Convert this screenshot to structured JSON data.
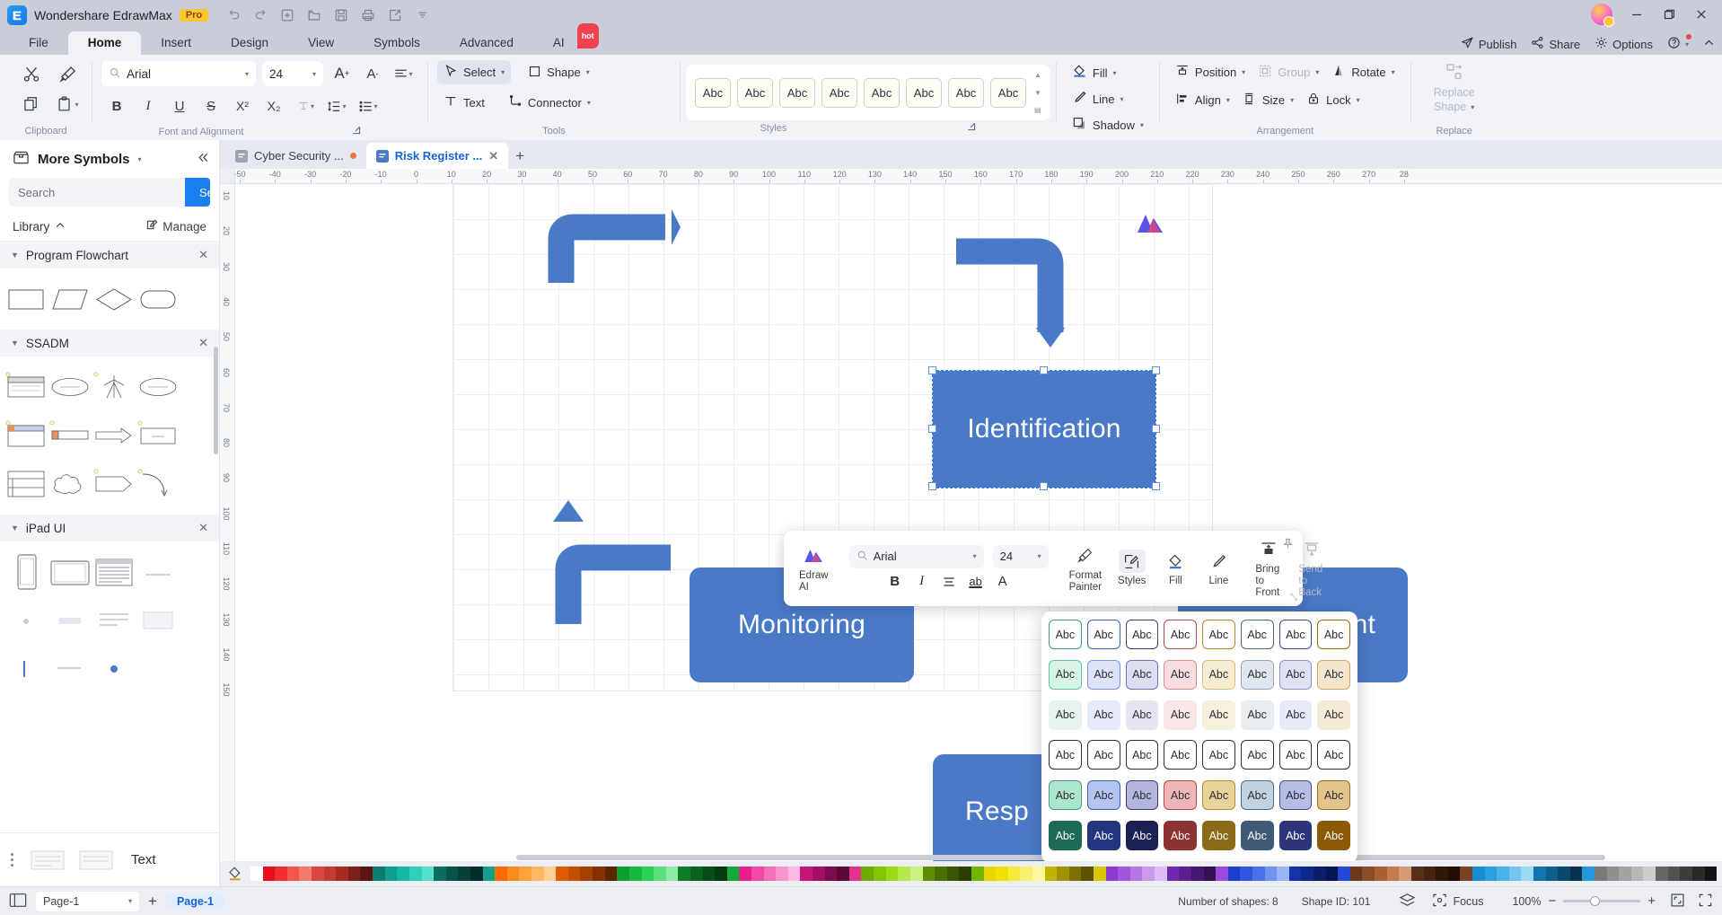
{
  "titlebar": {
    "app_name": "Wondershare EdrawMax",
    "badge": "Pro",
    "quick_access": [
      "undo-icon",
      "redo-icon",
      "new-icon",
      "open-icon",
      "save-icon",
      "print-icon",
      "export-icon",
      "more-icon"
    ],
    "window_controls": [
      "minimize",
      "maximize",
      "close"
    ]
  },
  "menu": {
    "tabs": [
      {
        "label": "File",
        "active": false
      },
      {
        "label": "Home",
        "active": true
      },
      {
        "label": "Insert",
        "active": false
      },
      {
        "label": "Design",
        "active": false
      },
      {
        "label": "View",
        "active": false
      },
      {
        "label": "Symbols",
        "active": false
      },
      {
        "label": "Advanced",
        "active": false
      },
      {
        "label": "AI",
        "active": false,
        "badge": "hot"
      }
    ],
    "right": [
      {
        "label": "Publish",
        "icon": "publish-icon"
      },
      {
        "label": "Share",
        "icon": "share-icon"
      },
      {
        "label": "Options",
        "icon": "gear-icon"
      },
      {
        "label": "",
        "icon": "help-icon"
      },
      {
        "label": "",
        "icon": "chevron-up-icon"
      }
    ]
  },
  "ribbon": {
    "groups": [
      {
        "name": "Clipboard",
        "label": "Clipboard"
      },
      {
        "name": "Font and Alignment",
        "label": "Font and Alignment"
      },
      {
        "name": "Tools",
        "label": "Tools"
      },
      {
        "name": "Styles",
        "label": "Styles"
      },
      {
        "name": "Arrangement",
        "label": "Arrangement"
      },
      {
        "name": "Replace",
        "label": "Replace"
      }
    ],
    "clipboard": {
      "cut": "cut-icon",
      "format_painter": "format-painter-icon",
      "copy": "copy-icon",
      "paste": "paste-icon"
    },
    "font": {
      "family": "Arial",
      "family_placeholder": "Arial",
      "size": "24",
      "grow": "A+",
      "shrink": "A-",
      "bold": "B",
      "italic": "I",
      "underline": "U",
      "strike": "S",
      "sup": "X²",
      "sub": "X₂",
      "text_effect": "text-effect-icon",
      "line_spacing": "line-spacing-icon",
      "bullets": "bullets-icon",
      "align": "align-icon",
      "highlight": "ab",
      "font_color": "A"
    },
    "tools": [
      {
        "label": "Select",
        "selected": true,
        "icon": "cursor-icon"
      },
      {
        "label": "Shape",
        "selected": false,
        "icon": "square-icon"
      },
      {
        "label": "Text",
        "selected": false,
        "icon": "text-icon"
      },
      {
        "label": "Connector",
        "selected": false,
        "icon": "connector-icon"
      }
    ],
    "styles_gallery": {
      "swatch_label": "Abc",
      "count": 8
    },
    "shape_format": [
      {
        "label": "Fill",
        "icon": "fill-icon"
      },
      {
        "label": "Line",
        "icon": "line-icon"
      },
      {
        "label": "Shadow",
        "icon": "shadow-icon"
      }
    ],
    "arrangement": [
      {
        "label": "Position",
        "icon": "position-icon",
        "disabled": false
      },
      {
        "label": "Group",
        "icon": "group-icon",
        "disabled": true
      },
      {
        "label": "Rotate",
        "icon": "rotate-icon",
        "disabled": false
      },
      {
        "label": "Align",
        "icon": "align-objects-icon",
        "disabled": false
      },
      {
        "label": "Size",
        "icon": "size-icon",
        "disabled": false
      },
      {
        "label": "Lock",
        "icon": "lock-icon",
        "disabled": false
      }
    ],
    "replace": {
      "label_line1": "Replace",
      "label_line2": "Shape",
      "icon": "replace-shape-icon",
      "disabled": true
    }
  },
  "sidebar": {
    "title": "More Symbols",
    "title_icon": "symbols-box-icon",
    "collapse_icon": "collapse-left-icon",
    "search": {
      "placeholder": "Search",
      "button": "Search",
      "value": ""
    },
    "library_label": "Library",
    "manage_label": "Manage",
    "categories": [
      {
        "name": "Program Flowchart",
        "shapes": [
          "rectangle",
          "parallelogram",
          "diamond",
          "rounded-rect"
        ]
      },
      {
        "name": "SSADM",
        "shapes": [
          "attribute-box",
          "external-entity",
          "resource-flow",
          "process-source",
          "window-form",
          "data-store-bar",
          "arrow",
          "entity-box",
          "entity-table",
          "cloud",
          "arrow-pentagon",
          "curve-arrow"
        ]
      },
      {
        "name": "iPad UI",
        "shapes": [
          "ipad-portrait",
          "ipad-landscape",
          "ipad-list",
          "misc-1",
          "misc-2",
          "misc-3",
          "misc-4",
          "misc-5",
          "misc-6"
        ]
      }
    ],
    "footer_label": "Text"
  },
  "tabs": {
    "documents": [
      {
        "label": "Cyber Security ...",
        "active": false,
        "modified": true
      },
      {
        "label": "Risk Register ...",
        "active": true,
        "modified": false
      }
    ],
    "add_label": "+"
  },
  "ruler": {
    "h_ticks": [
      "-50",
      "-40",
      "-30",
      "-20",
      "-10",
      "0",
      "10",
      "20",
      "30",
      "40",
      "50",
      "60",
      "70",
      "80",
      "90",
      "100",
      "110",
      "120",
      "130",
      "140",
      "150",
      "160",
      "170",
      "180",
      "190",
      "200",
      "210",
      "220",
      "230",
      "240",
      "250",
      "260",
      "270",
      "28"
    ],
    "v_ticks": [
      "10",
      "20",
      "30",
      "40",
      "50",
      "60",
      "70",
      "80",
      "90",
      "100",
      "110",
      "120",
      "130",
      "140",
      "150"
    ]
  },
  "canvas": {
    "nodes": [
      {
        "id": "identification",
        "label": "Identification",
        "selected": true
      },
      {
        "id": "monitoring",
        "label": "Monitoring",
        "selected": false
      },
      {
        "id": "assessment",
        "label": "nt",
        "selected": false
      },
      {
        "id": "response",
        "label": "Resp",
        "selected": false
      }
    ],
    "watermark": "edraw-ai-logo"
  },
  "context_toolbar": {
    "brand": "Edraw AI",
    "font_family": "Arial",
    "font_size": "24",
    "buttons": [
      "B",
      "I",
      "align-icon",
      "ab",
      "A"
    ],
    "items": [
      {
        "label": "Format Painter",
        "icon": "format-painter-icon",
        "disabled": false,
        "selected": false
      },
      {
        "label": "Styles",
        "icon": "styles-icon",
        "disabled": false,
        "selected": true
      },
      {
        "label": "Fill",
        "icon": "fill-icon",
        "disabled": false,
        "selected": false
      },
      {
        "label": "Line",
        "icon": "line-icon",
        "disabled": false,
        "selected": false
      },
      {
        "label": "Bring to Front",
        "icon": "bring-front-icon",
        "disabled": false,
        "selected": false
      },
      {
        "label": "Send to Back",
        "icon": "send-back-icon",
        "disabled": true,
        "selected": false
      }
    ],
    "pin_icon": "pin-icon"
  },
  "styles_popup": {
    "swatch_label": "Abc",
    "rows": [
      [
        {
          "bg": "#ffffff",
          "border": "#3f9d7d",
          "color": "#2b2d35"
        },
        {
          "bg": "#ffffff",
          "border": "#3b5fb5",
          "color": "#2b2d35"
        },
        {
          "bg": "#ffffff",
          "border": "#3b3f77",
          "color": "#2b2d35"
        },
        {
          "bg": "#ffffff",
          "border": "#b04a4a",
          "color": "#2b2d35"
        },
        {
          "bg": "#ffffff",
          "border": "#b38a2b",
          "color": "#2b2d35"
        },
        {
          "bg": "#ffffff",
          "border": "#4a6b8a",
          "color": "#2b2d35"
        },
        {
          "bg": "#ffffff",
          "border": "#3d4a8f",
          "color": "#2b2d35"
        },
        {
          "bg": "#ffffff",
          "border": "#9a6b1e",
          "color": "#2b2d35"
        }
      ],
      [
        {
          "bg": "#d9f3e6",
          "border": "#59c79c",
          "color": "#2b2d35"
        },
        {
          "bg": "#dde4f8",
          "border": "#7b93dd",
          "color": "#2b2d35"
        },
        {
          "bg": "#dcdef0",
          "border": "#6e72ad",
          "color": "#2b2d35"
        },
        {
          "bg": "#f8dede",
          "border": "#dd8c8c",
          "color": "#2b2d35"
        },
        {
          "bg": "#f6edd5",
          "border": "#d9bc72",
          "color": "#2b2d35"
        },
        {
          "bg": "#e0e7ee",
          "border": "#93a8bd",
          "color": "#2b2d35"
        },
        {
          "bg": "#dfe2f3",
          "border": "#8a90cd",
          "color": "#2b2d35"
        },
        {
          "bg": "#f3e6cd",
          "border": "#cda863",
          "color": "#2b2d35"
        }
      ],
      [
        {
          "bg": "#e4f4ec",
          "border": "transparent",
          "color": "#2b2d35"
        },
        {
          "bg": "#e4eaf9",
          "border": "transparent",
          "color": "#2b2d35"
        },
        {
          "bg": "#e5e6f2",
          "border": "transparent",
          "color": "#2b2d35"
        },
        {
          "bg": "#f9e7e7",
          "border": "transparent",
          "color": "#2b2d35"
        },
        {
          "bg": "#f7f0dc",
          "border": "transparent",
          "color": "#2b2d35"
        },
        {
          "bg": "#e8edf2",
          "border": "transparent",
          "color": "#2b2d35"
        },
        {
          "bg": "#e7e9f6",
          "border": "transparent",
          "color": "#2b2d35"
        },
        {
          "bg": "#f5ead6",
          "border": "transparent",
          "color": "#2b2d35"
        }
      ],
      [
        {
          "bg": "#ffffff",
          "border": "#2f2f33",
          "color": "#2b2d35"
        },
        {
          "bg": "#ffffff",
          "border": "#2f2f33",
          "color": "#2b2d35"
        },
        {
          "bg": "#ffffff",
          "border": "#2f2f33",
          "color": "#2b2d35"
        },
        {
          "bg": "#ffffff",
          "border": "#2f2f33",
          "color": "#2b2d35"
        },
        {
          "bg": "#ffffff",
          "border": "#2f2f33",
          "color": "#2b2d35"
        },
        {
          "bg": "#ffffff",
          "border": "#2f2f33",
          "color": "#2b2d35"
        },
        {
          "bg": "#ffffff",
          "border": "#2f2f33",
          "color": "#2b2d35"
        },
        {
          "bg": "#ffffff",
          "border": "#2f2f33",
          "color": "#2b2d35"
        }
      ],
      [
        {
          "bg": "#aee5cd",
          "border": "#3f9d7d",
          "color": "#2b2d35"
        },
        {
          "bg": "#b6c4f0",
          "border": "#3b5fb5",
          "color": "#2b2d35"
        },
        {
          "bg": "#b2b5dd",
          "border": "#3b3f77",
          "color": "#2b2d35"
        },
        {
          "bg": "#eeb6b6",
          "border": "#b04a4a",
          "color": "#2b2d35"
        },
        {
          "bg": "#e8d39a",
          "border": "#b38a2b",
          "color": "#2b2d35"
        },
        {
          "bg": "#c2d2de",
          "border": "#4a6b8a",
          "color": "#2b2d35"
        },
        {
          "bg": "#b8bde6",
          "border": "#3d4a8f",
          "color": "#2b2d35"
        },
        {
          "bg": "#e4c48d",
          "border": "#9a6b1e",
          "color": "#2b2d35"
        }
      ],
      [
        {
          "bg": "#1d6b55",
          "border": "#1d6b55",
          "color": "#ffffff"
        },
        {
          "bg": "#23357e",
          "border": "#23357e",
          "color": "#ffffff"
        },
        {
          "bg": "#1c2154",
          "border": "#1c2154",
          "color": "#ffffff"
        },
        {
          "bg": "#8e3333",
          "border": "#8e3333",
          "color": "#ffffff"
        },
        {
          "bg": "#8a6a16",
          "border": "#8a6a16",
          "color": "#ffffff"
        },
        {
          "bg": "#3f5a74",
          "border": "#3f5a74",
          "color": "#ffffff"
        },
        {
          "bg": "#2c357c",
          "border": "#2c357c",
          "color": "#ffffff"
        },
        {
          "bg": "#8a5a08",
          "border": "#8a5a08",
          "color": "#ffffff"
        }
      ]
    ]
  },
  "palette": {
    "colors": [
      "#ffffff",
      "#e8101a",
      "#f03030",
      "#f2564d",
      "#f27a6a",
      "#d9463c",
      "#c23a31",
      "#a32c24",
      "#7e201a",
      "#5c1512",
      "#0b7d6e",
      "#0f9e8c",
      "#14b8a2",
      "#2fd0b7",
      "#57e0cb",
      "#0a6d60",
      "#085349",
      "#064039",
      "#042e29",
      "#12a08c",
      "#ff6a00",
      "#ff8a1e",
      "#ffa23c",
      "#ffb866",
      "#ffd199",
      "#e05c00",
      "#c24f00",
      "#a34200",
      "#803300",
      "#5c2500",
      "#0f9d2f",
      "#18b83c",
      "#28d155",
      "#5ae07f",
      "#8fe9a8",
      "#0c7d24",
      "#09631c",
      "#074d15",
      "#05390f",
      "#16a83a",
      "#e81e8c",
      "#f24aa5",
      "#f56fb8",
      "#f895cc",
      "#fbbbe0",
      "#c4157a",
      "#a01063",
      "#7d0c4d",
      "#5c0938",
      "#e0338f",
      "#6ea800",
      "#84c400",
      "#9adb14",
      "#b5e84d",
      "#cdf083",
      "#5c8c00",
      "#4a7000",
      "#3a5700",
      "#2b4000",
      "#74b300",
      "#e8d400",
      "#f2e000",
      "#f7ea3a",
      "#faf06e",
      "#fcf69e",
      "#c4b200",
      "#a09100",
      "#7d7100",
      "#5c5300",
      "#d9c800",
      "#8c3ad1",
      "#a057de",
      "#b577e6",
      "#c99aee",
      "#ddbdf5",
      "#7028b0",
      "#5c1f91",
      "#471873",
      "#331154",
      "#9c4ade",
      "#1a3fd1",
      "#2e57de",
      "#4a72e6",
      "#7093ee",
      "#9bb4f5",
      "#1432ab",
      "#0f288c",
      "#0b1e6e",
      "#07144f",
      "#2448d9",
      "#6b3a1e",
      "#8a4d28",
      "#a86032",
      "#c47a4a",
      "#d89a72",
      "#563016",
      "#42250f",
      "#2e1909",
      "#1f1006",
      "#7a4424",
      "#1a8cd1",
      "#2e9fde",
      "#4ab2e6",
      "#70c6ee",
      "#9bdaf5",
      "#1474ab",
      "#0f5e8c",
      "#0b486e",
      "#07334f",
      "#2498d9",
      "#7a7a7a",
      "#8f8f8f",
      "#a3a3a3",
      "#b8b8b8",
      "#cccccc",
      "#666666",
      "#525252",
      "#3d3d3d",
      "#292929",
      "#141414"
    ]
  },
  "status": {
    "page_selector": "Page-1",
    "add_page": "+",
    "page_chip": "Page-1",
    "shapes_count": "Number of shapes: 8",
    "shape_id": "Shape ID: 101",
    "focus": "Focus",
    "zoom": "100%",
    "zoom_out": "−",
    "zoom_in": "+",
    "fit_icon": "fit-page-icon",
    "fullscreen_icon": "fullscreen-icon",
    "layers_icon": "layers-icon",
    "focus_icon": "focus-icon",
    "view_icon": "view-mode-icon"
  }
}
